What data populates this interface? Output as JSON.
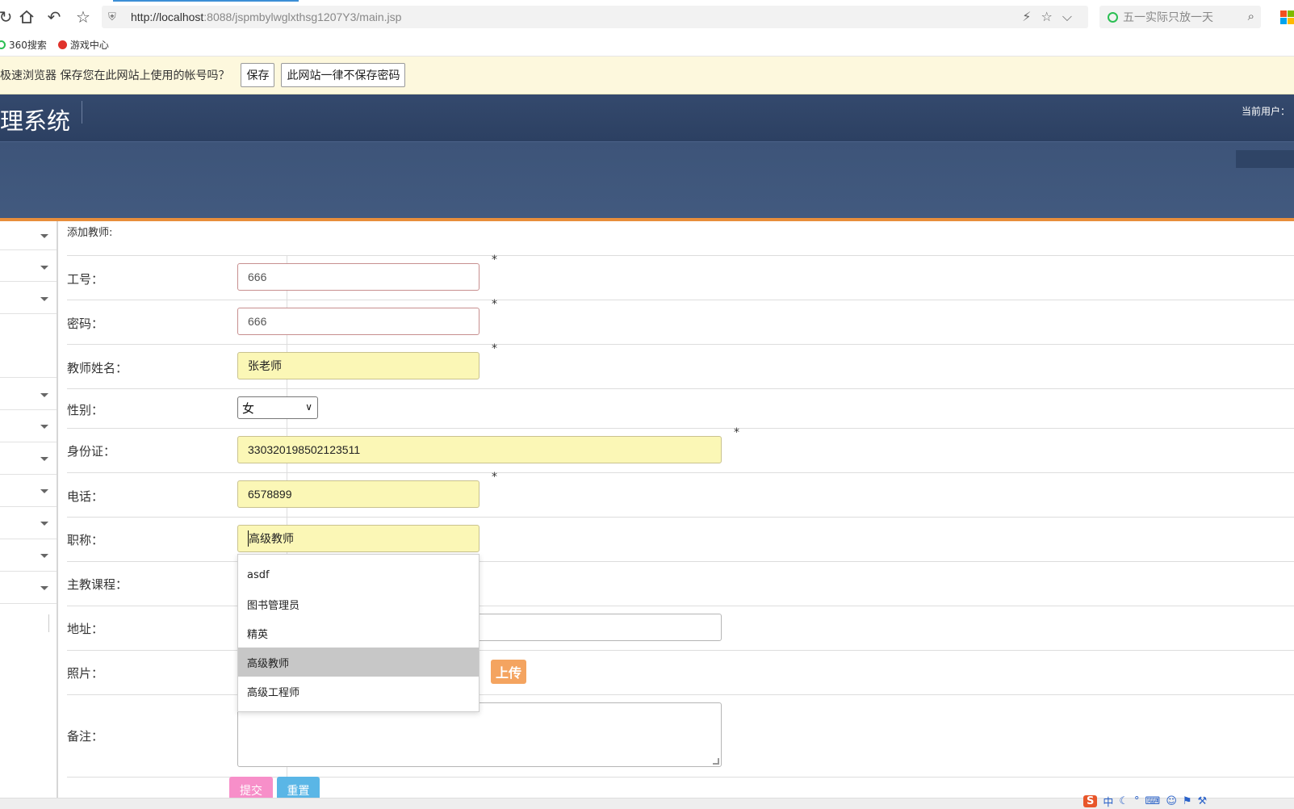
{
  "browser": {
    "url_host": "http://localhost",
    "url_rest": ":8088/jspmbylwglxthsg1207Y3/main.jsp",
    "search_placeholder": "五一实际只放一天",
    "bookmarks": [
      {
        "label": "360搜索",
        "color": "#2bbf53"
      },
      {
        "label": "游戏中心",
        "color": "#e0322b"
      }
    ]
  },
  "password_bar": {
    "message": "极速浏览器 保存您在此网站上使用的帐号吗？",
    "save_label": "保存",
    "never_label": "此网站一律不保存密码"
  },
  "app": {
    "title": "理系统",
    "current_user": "当前用户："
  },
  "form": {
    "caption": "添加教师:",
    "fields": {
      "job_no": {
        "label": "工号：",
        "value": "666"
      },
      "password": {
        "label": "密码：",
        "value": "666"
      },
      "name": {
        "label": "教师姓名：",
        "value": "张老师"
      },
      "gender": {
        "label": "性别：",
        "value": "女"
      },
      "id_card": {
        "label": "身份证：",
        "value": "330320198502123511"
      },
      "phone": {
        "label": "电话：",
        "value": "6578899"
      },
      "title": {
        "label": "职称：",
        "value": "高级教师"
      },
      "course": {
        "label": "主教课程："
      },
      "address": {
        "label": "地址："
      },
      "photo": {
        "label": "照片：",
        "upload_label": "上传"
      },
      "remark": {
        "label": "备注："
      }
    },
    "required_mark": "*",
    "title_suggestions": [
      "asdf",
      "图书管理员",
      "精英",
      "高级教师",
      "高级工程师"
    ],
    "active_suggestion_index": 3,
    "submit_label": "提交",
    "reset_label": "重置"
  },
  "ime": {
    "label": "中"
  },
  "colors": {
    "header": "#2e4365",
    "accent_line": "#e88e3b",
    "autofill_yellow": "#fbf7b6",
    "upload": "#f4a460",
    "submit": "#f78fc9",
    "reset": "#5ab6e6"
  }
}
